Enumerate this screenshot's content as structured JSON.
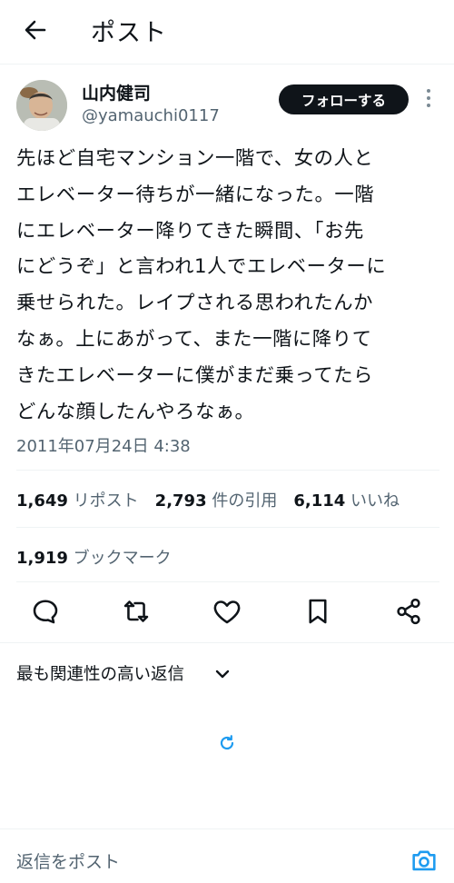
{
  "header": {
    "title": "ポスト"
  },
  "author": {
    "display_name": "山内健司",
    "handle": "@yamauchi0117",
    "follow_label": "フォローする"
  },
  "tweet": {
    "text": "先ほど自宅マンション一階で、女の人と\nエレベーター待ちが一緒になった。一階\nにエレベーター降りてきた瞬間、「お先\nにどうぞ」と言われ1人でエレベーターに\n乗せられた。レイプされる思われたんか\nなぁ。上にあがって、また一階に降りて\nきたエレベーターに僕がまだ乗ってたら\nどんな顔したんやろなぁ。",
    "timestamp": "2011年07月24日 4:38"
  },
  "stats": {
    "reposts": {
      "count": "1,649",
      "label": "リポスト"
    },
    "quotes": {
      "count": "2,793",
      "label": "件の引用"
    },
    "likes": {
      "count": "6,114",
      "label": "いいね"
    },
    "bookmarks": {
      "count": "1,919",
      "label": "ブックマーク"
    }
  },
  "actions": [
    "reply-icon",
    "repost-icon",
    "like-icon",
    "bookmark-icon",
    "share-icon"
  ],
  "replies": {
    "sort_label": "最も関連性の高い返信"
  },
  "composer": {
    "placeholder": "返信をポスト"
  },
  "colors": {
    "text": "#0f1419",
    "secondary": "#536471",
    "accent": "#1d9bf0",
    "divider": "#eff3f4"
  }
}
